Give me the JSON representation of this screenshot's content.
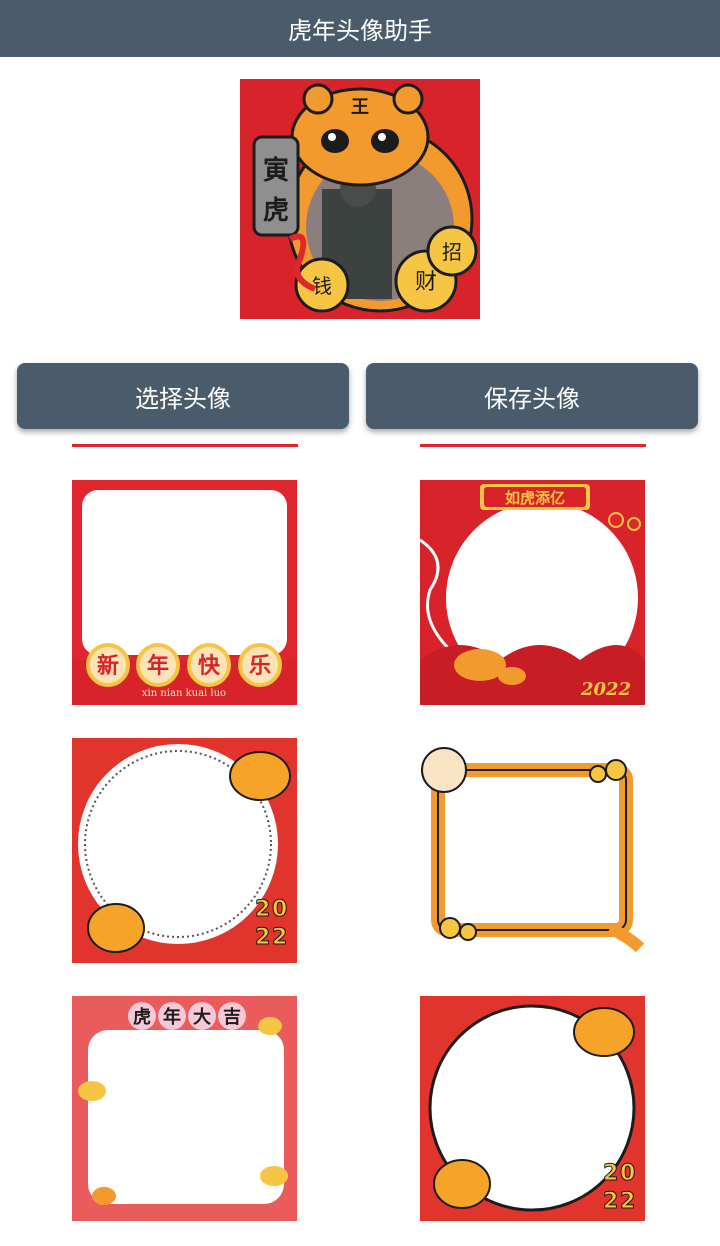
{
  "app": {
    "title": "虎年头像助手"
  },
  "preview": {
    "badge_text": "寅虎",
    "coin_left": "钱",
    "coin_right": "财",
    "coin_top": "招"
  },
  "buttons": {
    "select_label": "选择头像",
    "save_label": "保存头像"
  },
  "frames": [
    {
      "id": "xinnian",
      "chars": [
        "新",
        "年",
        "快",
        "乐"
      ],
      "pinyin": "xin nian kuai luo"
    },
    {
      "id": "ruhu",
      "banner": "如虎添亿",
      "year": "2022"
    },
    {
      "id": "circle-tigers-1",
      "year_digits": [
        "2",
        "0",
        "2",
        "2"
      ]
    },
    {
      "id": "tiger-square"
    },
    {
      "id": "hunian-daji",
      "chars": [
        "虎",
        "年",
        "大",
        "吉"
      ]
    },
    {
      "id": "circle-tigers-2",
      "year_digits": [
        "2",
        "0",
        "2",
        "2"
      ]
    }
  ],
  "colors": {
    "header": "#4a5c6b",
    "festive_red": "#e0262d",
    "gold": "#f6c544",
    "tiger_orange": "#f29a2e"
  }
}
